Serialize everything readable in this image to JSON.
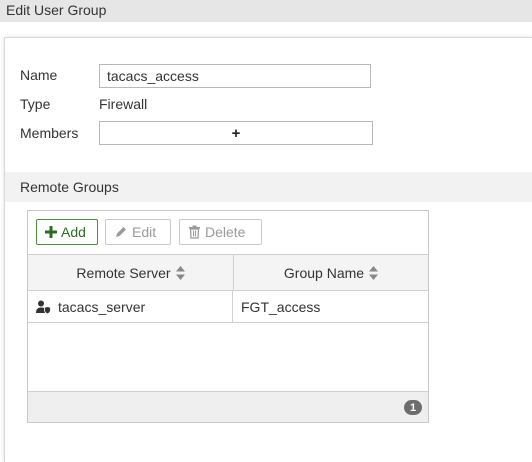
{
  "header": {
    "title": "Edit User Group"
  },
  "form": {
    "name_label": "Name",
    "name_value": "tacacs_access",
    "type_label": "Type",
    "type_value": "Firewall",
    "members_label": "Members",
    "members_add_icon": "+"
  },
  "remote_groups": {
    "section_title": "Remote Groups",
    "toolbar": {
      "add_label": "Add",
      "edit_label": "Edit",
      "delete_label": "Delete"
    },
    "columns": [
      "Remote Server",
      "Group Name"
    ],
    "rows": [
      {
        "remote_server": "tacacs_server",
        "group_name": "FGT_access",
        "icon": "user-shield-icon"
      }
    ],
    "count": "1"
  },
  "colors": {
    "accent_green": "#2e6a22",
    "header_bg": "#e6e6e6",
    "badge_bg": "#6d6d6d"
  }
}
